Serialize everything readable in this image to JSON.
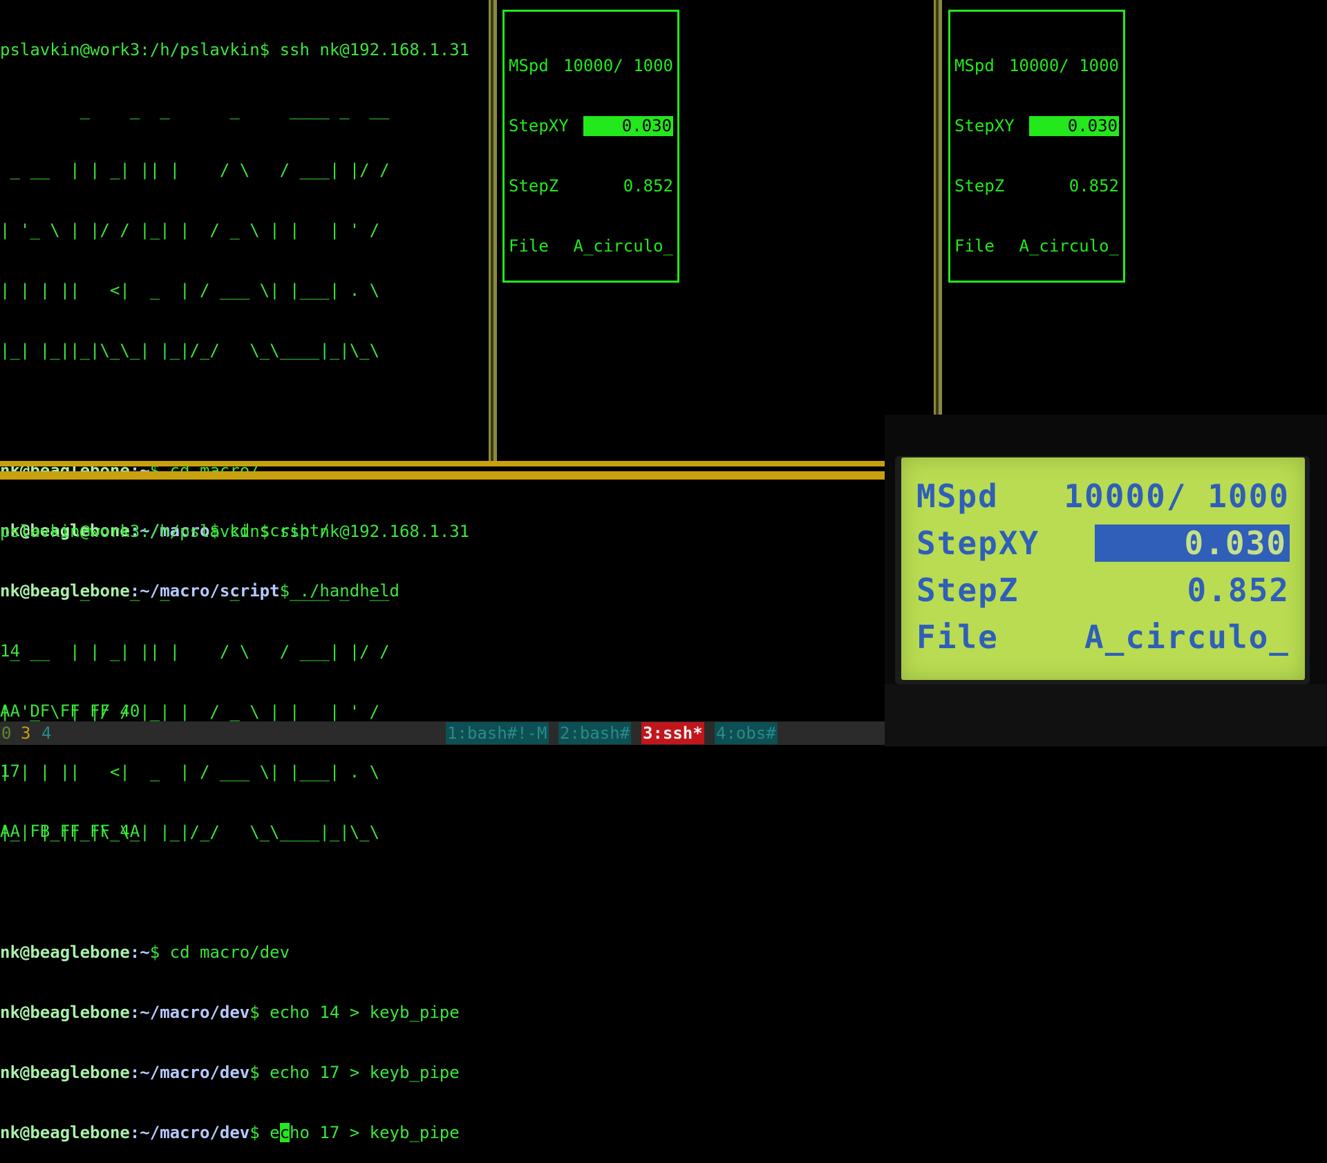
{
  "top_pane": {
    "prompt_line": "pslavkin@work3:/h/pslavkin$ ssh nk@192.168.1.31",
    "ascii_art": [
      "        _    _  _      _     ____ _  __",
      " _ __  | | _| || |    / \\   / ___| |/ /",
      "| '_ \\ | |/ / |_| |  / _ \\ | |   | ' / ",
      "| | | ||   <|  _  | / ___ \\| |___| . \\ ",
      "|_| |_||_|\\_\\_| |_|/_/   \\_\\____|_|\\_\\"
    ],
    "lines": [
      {
        "user": "nk@beaglebone",
        "path": ":~",
        "cmd": "$ cd macro/"
      },
      {
        "user": "nk@beaglebone",
        "path": ":~/macro",
        "cmd": "$ cd script/"
      },
      {
        "user": "nk@beaglebone",
        "path": ":~/macro/script",
        "cmd": "$ ./handheld"
      }
    ],
    "output": [
      "14",
      "AA DF FF FF 40",
      "17",
      "AA FB FF FF 4A"
    ]
  },
  "bottom_pane": {
    "prompt_line": "pslavkin@work3:/h/pslavkin$ ssh nk@192.168.1.31",
    "ascii_art": [
      "        _    _  _      _     ____ _  __",
      " _ __  | | _| || |    / \\   / ___| |/ /",
      "| '_ \\ | |/ / |_| |  / _ \\ | |   | ' / ",
      "| | | ||   <|  _  | / ___ \\| |___| . \\ ",
      "|_| |_||_|\\_\\_| |_|/_/   \\_\\____|_|\\_\\"
    ],
    "lines": [
      {
        "user": "nk@beaglebone",
        "path": ":~",
        "cmd": "$ cd macro/dev"
      },
      {
        "user": "nk@beaglebone",
        "path": ":~/macro/dev",
        "cmd": "$ echo 14 > keyb_pipe"
      },
      {
        "user": "nk@beaglebone",
        "path": ":~/macro/dev",
        "cmd": "$ echo 17 > keyb_pipe"
      }
    ],
    "last_line": {
      "user": "nk@beaglebone",
      "path": ":~/macro/dev",
      "cmd_pre": "$ e",
      "cursor_char": "c",
      "cmd_post": "ho 17 > keyb_pipe"
    }
  },
  "lcd": {
    "mspd_label": "MSpd",
    "mspd_value": "10000/ 1000",
    "stepxy_label": "StepXY",
    "stepxy_value": "0.030",
    "stepz_label": "StepZ",
    "stepz_value": "0.852",
    "file_label": "File",
    "file_value": "A_circulo_"
  },
  "photo_lcd": {
    "mspd_label": "MSpd",
    "mspd_value": "10000/ 1000",
    "stepxy_label": "StepXY",
    "stepxy_value": "0.030",
    "stepz_label": "StepZ",
    "stepz_value": "0.852",
    "file_label": "File",
    "file_value": "A_circulo_"
  },
  "status_bar": {
    "sessions": [
      "0",
      "3",
      "4"
    ],
    "windows": [
      {
        "label": "1:bash#!-M",
        "color": "#0d4f52",
        "text": "#2a8a8a"
      },
      {
        "label": "2:bash#",
        "color": "#0d4f52",
        "text": "#2a8a8a"
      },
      {
        "label": "3:ssh*",
        "color": "#c0161c",
        "text": "#f0f0f0"
      },
      {
        "label": "4:obs#",
        "color": "#0d4f52",
        "text": "#2a8a8a"
      }
    ]
  },
  "colors": {
    "terminal_green": "#3be63b",
    "divider_yellow": "#c9a010",
    "lcd_background": "#b9dc52",
    "lcd_text": "#2f5fb8"
  }
}
